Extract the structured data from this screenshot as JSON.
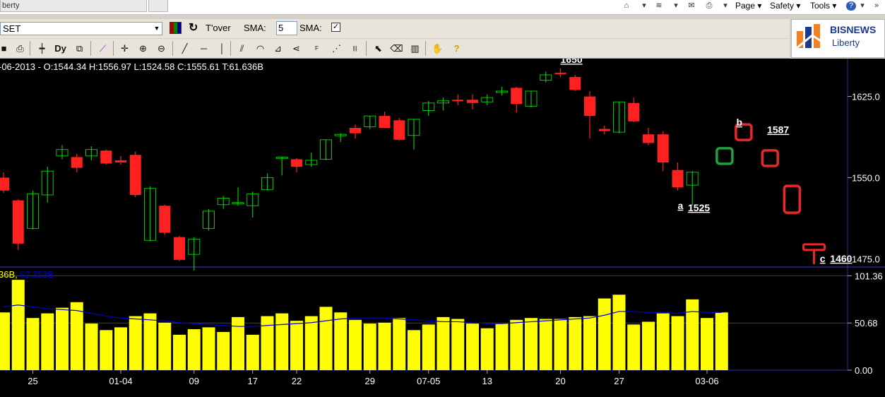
{
  "browser": {
    "tab_title": "berty",
    "menu": {
      "page": "Page",
      "safety": "Safety",
      "tools": "Tools"
    }
  },
  "toolbar": {
    "symbol": "SET",
    "tover_label": "T'over",
    "sma_label": "SMA:",
    "sma_value": "5",
    "sma_label2": "SMA:"
  },
  "logo": {
    "name": "BISNEWS",
    "sub": "Liberty"
  },
  "colors": {
    "bull": "#00c800",
    "bear": "#ff2020",
    "volume": "#ffff00",
    "volume_ma": "#0000c8",
    "background": "#000000",
    "pattern_green": "#20a040",
    "pattern_red": "#e82828"
  },
  "chart_data": [
    {
      "type": "candlestick",
      "info_line": "-06-2013 - O:1544.34 H:1556.97 L:1524.58 C:1555.61 T:61.636B",
      "ylim": [
        1468,
        1660
      ],
      "y_ticks": [
        {
          "value": 1625,
          "label": "1625.0"
        },
        {
          "value": 1550,
          "label": "1550.0"
        },
        {
          "value": 1475,
          "label": "1475.0"
        }
      ],
      "x_ticks": [
        {
          "index": 2,
          "label": "25"
        },
        {
          "index": 8,
          "label": "01-04"
        },
        {
          "index": 13,
          "label": "09"
        },
        {
          "index": 17,
          "label": "17"
        },
        {
          "index": 20,
          "label": "22"
        },
        {
          "index": 25,
          "label": "29"
        },
        {
          "index": 29,
          "label": "07-05"
        },
        {
          "index": 33,
          "label": "13"
        },
        {
          "index": 38,
          "label": "20"
        },
        {
          "index": 42,
          "label": "27"
        },
        {
          "index": 48,
          "label": "03-06"
        }
      ],
      "candles": [
        {
          "o": 1550,
          "h": 1555,
          "l": 1536,
          "c": 1538
        },
        {
          "o": 1529,
          "h": 1530,
          "l": 1483,
          "c": 1489
        },
        {
          "o": 1503,
          "h": 1538,
          "l": 1502,
          "c": 1535
        },
        {
          "o": 1534,
          "h": 1560,
          "l": 1527,
          "c": 1556
        },
        {
          "o": 1570,
          "h": 1580,
          "l": 1567,
          "c": 1576
        },
        {
          "o": 1569,
          "h": 1572,
          "l": 1555,
          "c": 1559
        },
        {
          "o": 1570,
          "h": 1579,
          "l": 1566,
          "c": 1576
        },
        {
          "o": 1575,
          "h": 1576,
          "l": 1562,
          "c": 1563
        },
        {
          "o": 1566,
          "h": 1570,
          "l": 1562,
          "c": 1564
        },
        {
          "o": 1571,
          "h": 1574,
          "l": 1532,
          "c": 1534
        },
        {
          "o": 1492,
          "h": 1542,
          "l": 1491,
          "c": 1540
        },
        {
          "o": 1524,
          "h": 1525,
          "l": 1497,
          "c": 1499
        },
        {
          "o": 1495,
          "h": 1496,
          "l": 1473,
          "c": 1474
        },
        {
          "o": 1479,
          "h": 1495,
          "l": 1464,
          "c": 1493
        },
        {
          "o": 1503,
          "h": 1521,
          "l": 1501,
          "c": 1519
        },
        {
          "o": 1525,
          "h": 1533,
          "l": 1521,
          "c": 1531
        },
        {
          "o": 1527,
          "h": 1541,
          "l": 1524,
          "c": 1527
        },
        {
          "o": 1524,
          "h": 1537,
          "l": 1513,
          "c": 1535
        },
        {
          "o": 1539,
          "h": 1554,
          "l": 1538,
          "c": 1550
        },
        {
          "o": 1569,
          "h": 1569,
          "l": 1552,
          "c": 1569
        },
        {
          "o": 1567,
          "h": 1568,
          "l": 1555,
          "c": 1560
        },
        {
          "o": 1562,
          "h": 1573,
          "l": 1560,
          "c": 1566
        },
        {
          "o": 1567,
          "h": 1585,
          "l": 1566,
          "c": 1585
        },
        {
          "o": 1590,
          "h": 1591,
          "l": 1583,
          "c": 1590
        },
        {
          "o": 1596,
          "h": 1599,
          "l": 1586,
          "c": 1591
        },
        {
          "o": 1597,
          "h": 1607,
          "l": 1595,
          "c": 1607
        },
        {
          "o": 1607,
          "h": 1611,
          "l": 1596,
          "c": 1596
        },
        {
          "o": 1603,
          "h": 1605,
          "l": 1584,
          "c": 1585
        },
        {
          "o": 1589,
          "h": 1604,
          "l": 1576,
          "c": 1604
        },
        {
          "o": 1612,
          "h": 1621,
          "l": 1607,
          "c": 1619
        },
        {
          "o": 1619,
          "h": 1624,
          "l": 1612,
          "c": 1621
        },
        {
          "o": 1622,
          "h": 1627,
          "l": 1617,
          "c": 1621
        },
        {
          "o": 1622,
          "h": 1627,
          "l": 1613,
          "c": 1619
        },
        {
          "o": 1620,
          "h": 1627,
          "l": 1617,
          "c": 1624
        },
        {
          "o": 1630,
          "h": 1634,
          "l": 1626,
          "c": 1630
        },
        {
          "o": 1633,
          "h": 1634,
          "l": 1610,
          "c": 1618
        },
        {
          "o": 1616,
          "h": 1630,
          "l": 1615,
          "c": 1630
        },
        {
          "o": 1640,
          "h": 1648,
          "l": 1638,
          "c": 1645
        },
        {
          "o": 1647,
          "h": 1651,
          "l": 1643,
          "c": 1646
        },
        {
          "o": 1643,
          "h": 1645,
          "l": 1630,
          "c": 1631
        },
        {
          "o": 1625,
          "h": 1630,
          "l": 1586,
          "c": 1607
        },
        {
          "o": 1595,
          "h": 1598,
          "l": 1590,
          "c": 1593
        },
        {
          "o": 1592,
          "h": 1620,
          "l": 1591,
          "c": 1620
        },
        {
          "o": 1619,
          "h": 1624,
          "l": 1601,
          "c": 1602
        },
        {
          "o": 1590,
          "h": 1596,
          "l": 1580,
          "c": 1582
        },
        {
          "o": 1590,
          "h": 1593,
          "l": 1556,
          "c": 1564
        },
        {
          "o": 1557,
          "h": 1564,
          "l": 1538,
          "c": 1541
        },
        {
          "o": 1543,
          "h": 1556,
          "l": 1524,
          "c": 1555
        }
      ],
      "annotations": [
        {
          "label": "1650",
          "x": 38,
          "y": 1656
        },
        {
          "label": "b",
          "x": 50,
          "y": 1598
        },
        {
          "label": "1587",
          "x": 52.1,
          "y": 1591
        },
        {
          "label": "a",
          "x": 46,
          "y": 1521
        },
        {
          "label": "1525",
          "x": 46.7,
          "y": 1519
        },
        {
          "label": "c",
          "x": 55.7,
          "y": 1472
        },
        {
          "label": "1460",
          "x": 56.4,
          "y": 1472
        }
      ],
      "projected": [
        {
          "x": 49.2,
          "y": 1570,
          "color": "green",
          "shape": "box"
        },
        {
          "x": 50.5,
          "y": 1592,
          "color": "red",
          "shape": "box"
        },
        {
          "x": 52.3,
          "y": 1568,
          "color": "red",
          "shape": "box"
        },
        {
          "x": 53.8,
          "y": 1530,
          "color": "red",
          "shape": "box"
        },
        {
          "x": 55.3,
          "y": 1487,
          "color": "red",
          "shape": "cap"
        }
      ]
    },
    {
      "type": "bar",
      "legend": [
        {
          "text": "36B,",
          "color": "#ffff00"
        },
        {
          "text": "62.353B",
          "color": "#0000c8"
        }
      ],
      "ylim": [
        0,
        110
      ],
      "y_ticks": [
        {
          "value": 101.36,
          "label": "101.36"
        },
        {
          "value": 50.68,
          "label": "50.68"
        },
        {
          "value": 0,
          "label": "0.00"
        }
      ],
      "values": [
        62,
        97,
        56,
        61,
        67,
        73,
        50,
        43,
        46,
        58,
        61,
        51,
        38,
        44,
        46,
        41,
        57,
        38,
        58,
        61,
        53,
        58,
        68,
        62,
        54,
        50,
        51,
        56,
        43,
        49,
        57,
        55,
        50,
        45,
        50,
        54,
        56,
        55,
        55,
        57,
        58,
        77,
        81,
        49,
        52,
        61,
        58,
        76,
        56,
        62
      ],
      "ma": [
        68,
        70,
        68,
        66,
        65,
        64,
        61,
        58,
        56,
        55,
        54,
        53,
        51,
        50,
        49,
        48,
        47,
        47,
        48,
        49,
        50,
        51,
        53,
        55,
        56,
        56,
        56,
        55,
        54,
        53,
        52,
        52,
        51,
        50,
        50,
        51,
        52,
        53,
        54,
        55,
        56,
        59,
        63,
        63,
        62,
        62,
        61,
        63,
        62,
        62
      ]
    }
  ]
}
